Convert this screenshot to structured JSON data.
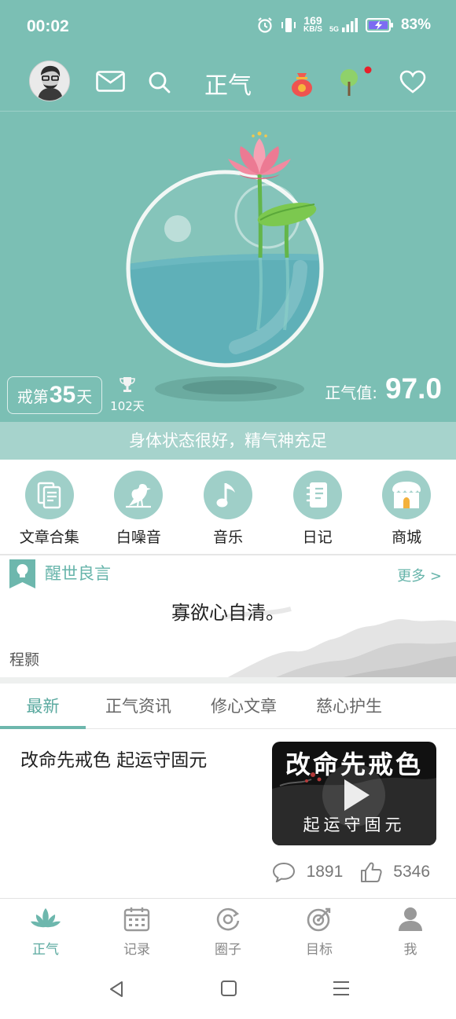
{
  "status_bar": {
    "time": "00:02",
    "net_speed_value": "169",
    "net_speed_unit": "KB/S",
    "network": "5G",
    "battery_percent": "83%"
  },
  "top_bar": {
    "title": "正气",
    "icons": [
      "avatar",
      "mail-icon",
      "search-icon",
      "lucky-bag-icon",
      "tree-icon",
      "heart-icon"
    ]
  },
  "hero": {
    "streak_prefix": "戒第",
    "streak_days": "35",
    "streak_suffix": "天",
    "record_days": "102天",
    "qi_label": "正气值:",
    "qi_value": "97.0",
    "state_text": "身体状态很好，精气神充足"
  },
  "quick_links": [
    {
      "label": "文章合集",
      "icon": "documents-icon"
    },
    {
      "label": "白噪音",
      "icon": "bird-icon"
    },
    {
      "label": "音乐",
      "icon": "music-note-icon"
    },
    {
      "label": "日记",
      "icon": "notebook-icon"
    },
    {
      "label": "商城",
      "icon": "shop-icon"
    }
  ],
  "quote": {
    "section_title": "醒世良言",
    "more_label": "更多 >",
    "text": "寡欲心自清。",
    "author": "程颢"
  },
  "tabs": [
    {
      "label": "最新",
      "active": true
    },
    {
      "label": "正气资讯",
      "active": false
    },
    {
      "label": "修心文章",
      "active": false
    },
    {
      "label": "慈心护生",
      "active": false
    }
  ],
  "article": {
    "title": "改命先戒色 起运守固元",
    "thumb_title": "改命先戒色",
    "thumb_subtitle": "起运守固元",
    "comments": "1891",
    "likes": "5346"
  },
  "bottom_nav": [
    {
      "label": "正气",
      "icon": "lotus-icon",
      "active": true
    },
    {
      "label": "记录",
      "icon": "calendar-icon",
      "active": false
    },
    {
      "label": "圈子",
      "icon": "circle-icon",
      "active": false
    },
    {
      "label": "目标",
      "icon": "target-icon",
      "active": false
    },
    {
      "label": "我",
      "icon": "person-icon",
      "active": false
    }
  ],
  "colors": {
    "primary": "#7bbfb4",
    "accent": "#5aa99f",
    "state_bar": "#a6d3cc",
    "icon_circle": "#9fcfc8"
  }
}
